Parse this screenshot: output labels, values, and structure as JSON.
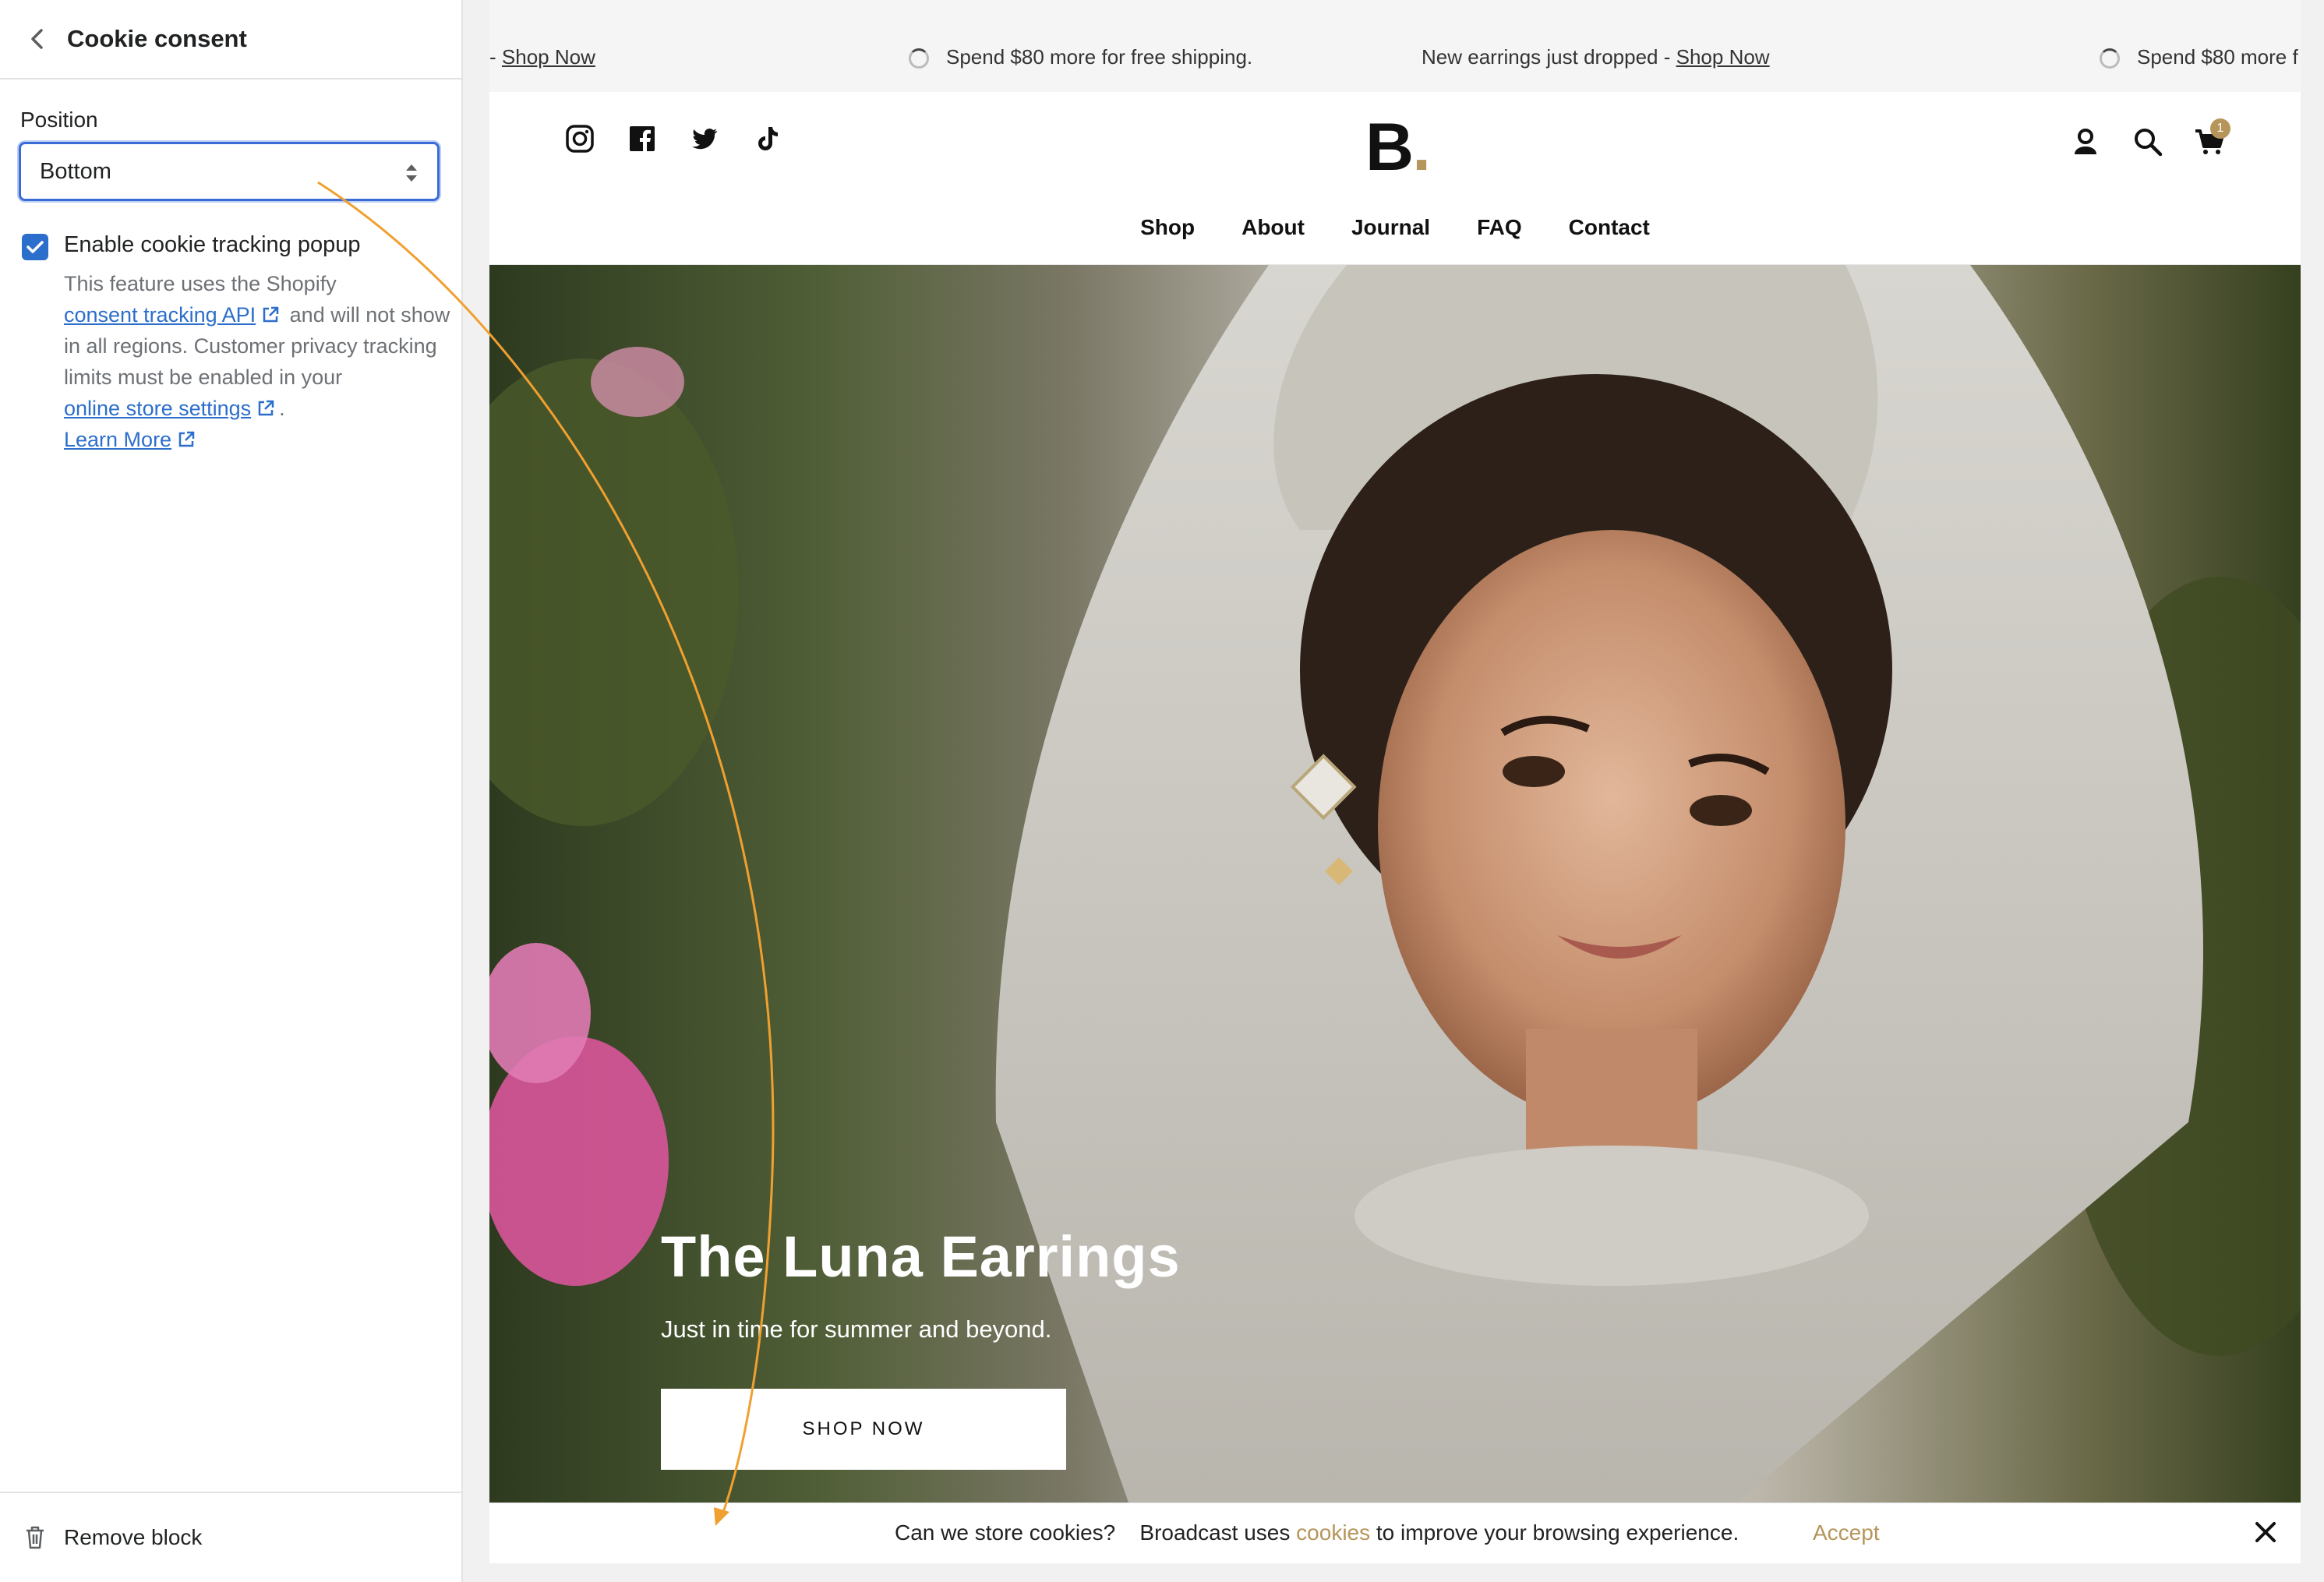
{
  "panel": {
    "title": "Cookie consent",
    "position_label": "Position",
    "position_value": "Bottom",
    "checkbox_label": "Enable cookie tracking popup",
    "help_part1": "This feature uses the Shopify",
    "help_link1": "consent tracking API",
    "help_part2": "and will not show in all regions. Customer privacy tracking limits must be enabled in your",
    "help_link2": "online store settings",
    "help_part3": ".",
    "help_link3": "Learn More",
    "remove_label": "Remove block"
  },
  "announcement": {
    "item1_prefix": "-",
    "item1_link": "Shop Now",
    "item2": "Spend $80 more for free shipping.",
    "item3": "New earrings just dropped -",
    "item3_link": "Shop Now",
    "item4": "Spend $80 more f"
  },
  "header": {
    "logo": "B",
    "logo_dot": ".",
    "cart_count": "1",
    "nav": [
      "Shop",
      "About",
      "Journal",
      "FAQ",
      "Contact"
    ]
  },
  "hero": {
    "title": "The Luna Earrings",
    "subtitle": "Just in time for summer and beyond.",
    "button": "SHOP NOW"
  },
  "cookie_bar": {
    "question": "Can we store cookies?",
    "text_before": "Broadcast uses",
    "link": "cookies",
    "text_after": "to improve your browsing experience.",
    "accept": "Accept"
  },
  "colors": {
    "accent": "#b5955a",
    "link": "#2c6ecb",
    "annotation_arrow": "#f0a030"
  }
}
